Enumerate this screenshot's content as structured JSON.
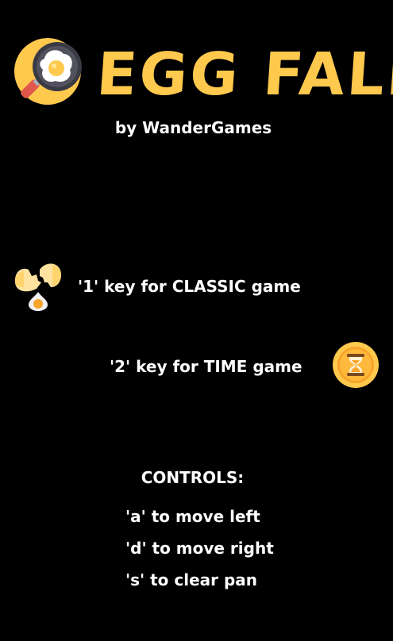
{
  "title": "EGG FALL",
  "subtitle": "by WanderGames",
  "modes": [
    {
      "label": "'1' key for CLASSIC game",
      "icon": "cracked-egg-icon"
    },
    {
      "label": "'2' key for TIME game",
      "icon": "hourglass-icon"
    }
  ],
  "controls": {
    "heading": "CONTROLS:",
    "items": [
      "'a' to move left",
      "'d' to move right",
      "'s' to clear pan"
    ]
  },
  "logo_icon": "frying-pan-egg-icon",
  "colors": {
    "background": "#000000",
    "title": "#FFC94D",
    "text": "#FFFFFF",
    "accent_orange": "#F7A529",
    "pan_dark": "#3A3A44"
  }
}
